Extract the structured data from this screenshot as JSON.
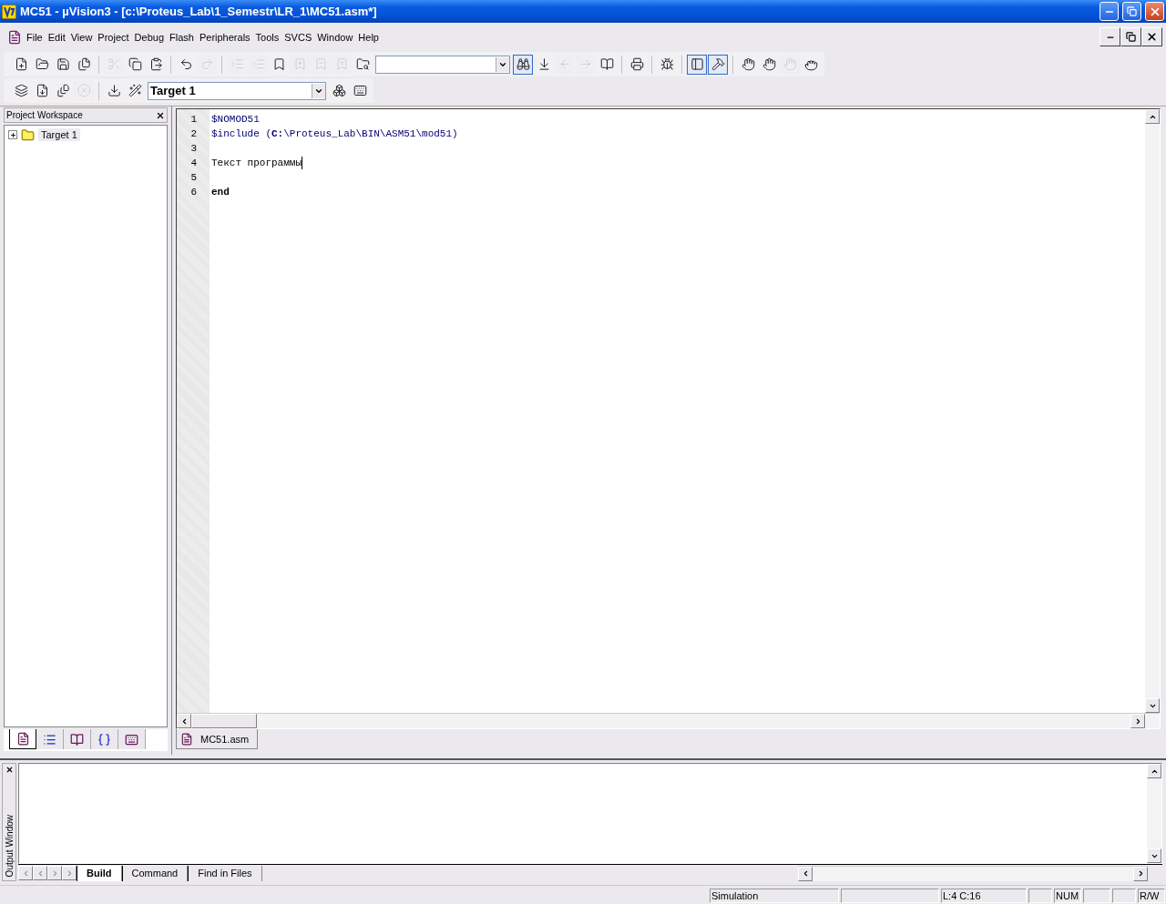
{
  "window": {
    "title": "MC51  - µVision3 - [c:\\Proteus_Lab\\1_Semestr\\LR_1\\MC51.asm*]"
  },
  "menu": [
    "File",
    "Edit",
    "View",
    "Project",
    "Debug",
    "Flash",
    "Peripherals",
    "Tools",
    "SVCS",
    "Window",
    "Help"
  ],
  "toolbar_1": [
    {
      "disabled": false,
      "pressed": false
    },
    {
      "disabled": false,
      "pressed": false
    },
    {
      "disabled": false,
      "pressed": false
    },
    {
      "disabled": false,
      "pressed": false
    },
    {
      "disabled": true,
      "pressed": false
    },
    {
      "disabled": false,
      "pressed": false
    },
    {
      "disabled": false,
      "pressed": false
    },
    {
      "disabled": false,
      "pressed": false
    },
    {
      "disabled": true,
      "pressed": false
    },
    {
      "disabled": true,
      "pressed": false
    },
    {
      "disabled": true,
      "pressed": false
    },
    {
      "disabled": false,
      "pressed": false
    },
    {
      "disabled": true,
      "pressed": false
    },
    {
      "disabled": true,
      "pressed": false
    },
    {
      "disabled": true,
      "pressed": false
    },
    {
      "disabled": false,
      "pressed": false
    },
    {
      "disabled": false,
      "pressed": true
    },
    {
      "disabled": false,
      "pressed": false
    },
    {
      "disabled": true,
      "pressed": false
    },
    {
      "disabled": true,
      "pressed": false
    },
    {
      "disabled": false,
      "pressed": false
    },
    {
      "disabled": false,
      "pressed": false
    },
    {
      "disabled": false,
      "pressed": false
    },
    {
      "disabled": false,
      "pressed": true
    },
    {
      "disabled": false,
      "pressed": true
    },
    {
      "disabled": false,
      "pressed": false
    },
    {
      "disabled": false,
      "pressed": false
    },
    {
      "disabled": true,
      "pressed": false
    },
    {
      "disabled": false,
      "pressed": false
    }
  ],
  "toolbar_2": [
    {
      "disabled": false
    },
    {
      "disabled": false
    },
    {
      "disabled": false
    },
    {
      "disabled": true
    },
    {
      "disabled": false
    },
    {
      "disabled": false
    },
    {
      "disabled": false
    },
    {
      "disabled": false
    }
  ],
  "target_combo": {
    "value": "Target 1"
  },
  "workspace": {
    "title": "Project Workspace",
    "tree": [
      {
        "label": "Target 1",
        "expanded": false
      }
    ],
    "tabs": [
      {
        "selected": true
      },
      {
        "selected": false
      },
      {
        "selected": false
      },
      {
        "selected": false
      },
      {
        "selected": false
      }
    ]
  },
  "editor": {
    "lines": [
      {
        "number": "1",
        "text": "$NOMOD51",
        "kind": "directive",
        "cursor": false
      },
      {
        "number": "2",
        "text": "$include (**C:**\\Proteus_Lab\\BIN\\ASM51\\mod51)",
        "kind": "directive",
        "cursor": false
      },
      {
        "number": "3",
        "cursor": false
      },
      {
        "number": "4",
        "text": "Текст программы",
        "kind": "text",
        "cursor": true
      },
      {
        "number": "5",
        "cursor": false
      },
      {
        "number": "6",
        "text": "end",
        "kind": "keyword",
        "cursor": false
      }
    ],
    "tabs": [
      {
        "label": "MC51.asm",
        "selected": true
      }
    ]
  },
  "output": {
    "title": "Output Window",
    "tabs": [
      {
        "label": "Build",
        "selected": true
      },
      {
        "label": "Command",
        "selected": false
      },
      {
        "label": "Find in Files",
        "selected": false
      }
    ]
  },
  "status_bar": {
    "mode": "Simulation",
    "position": "L:4 C:16",
    "num": "NUM",
    "access": "R/W"
  }
}
